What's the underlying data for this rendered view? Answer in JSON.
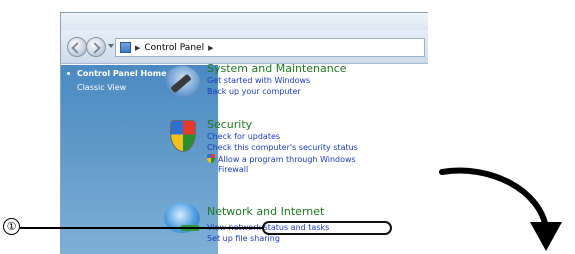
{
  "annotation": {
    "callout_number": "①"
  },
  "address_bar": {
    "location": "Control Panel"
  },
  "sidebar": {
    "home_label": "Control Panel Home",
    "classic_label": "Classic View"
  },
  "categories": [
    {
      "title": "System and Maintenance",
      "icon": "system-maintenance-icon",
      "links": [
        "Get started with Windows",
        "Back up your computer"
      ]
    },
    {
      "title": "Security",
      "icon": "security-shield-icon",
      "links": [
        "Check for updates",
        "Check this computer's security status",
        "Allow a program through Windows",
        "Firewall"
      ]
    },
    {
      "title": "Network and Internet",
      "icon": "network-globe-icon",
      "links": [
        "View network status and tasks",
        "Set up file sharing"
      ]
    }
  ],
  "colors": {
    "sidebar": "#5d98c8",
    "category_title": "#1e7a1e",
    "link": "#1a3dc4"
  }
}
